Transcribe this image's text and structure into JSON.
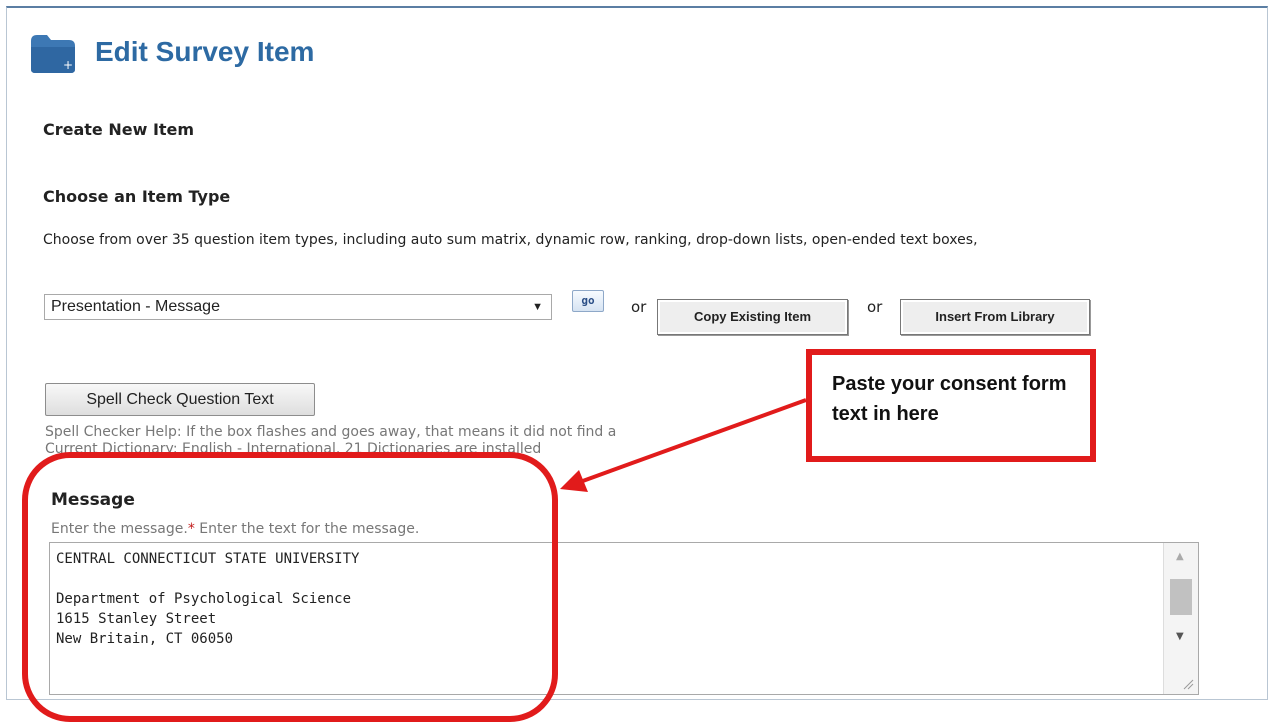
{
  "header": {
    "title": "Edit Survey Item",
    "icon": "folder-plus-icon"
  },
  "create_section": {
    "heading": "Create New Item"
  },
  "item_type": {
    "heading": "Choose an Item Type",
    "description": "Choose from over 35 question item types, including auto sum matrix, dynamic row, ranking, drop-down lists, open-ended text boxes,",
    "selected_type": "Presentation - Message",
    "go_label": "go",
    "or_label": "or",
    "copy_label": "Copy Existing Item",
    "library_label": "Insert From Library"
  },
  "spell_check": {
    "button_label": "Spell Check Question Text",
    "help_line1": "Spell Checker Help: If the box flashes and goes away, that means it did not find a",
    "help_line2": "Current Dictionary: English - International. 21 Dictionaries are installed"
  },
  "message": {
    "heading": "Message",
    "hint_prefix": "Enter the message.",
    "required_mark": "*",
    "hint_suffix": " Enter the text for the message.",
    "value": "CENTRAL CONNECTICUT STATE UNIVERSITY\n\nDepartment of Psychological Science\n1615 Stanley Street\nNew Britain, CT 06050"
  },
  "annotation": {
    "callout_text": "Paste your consent form text in here",
    "color": "#e11b1b"
  },
  "colors": {
    "title_blue": "#2d6aa3",
    "frame_border": "#5b7ea3"
  }
}
